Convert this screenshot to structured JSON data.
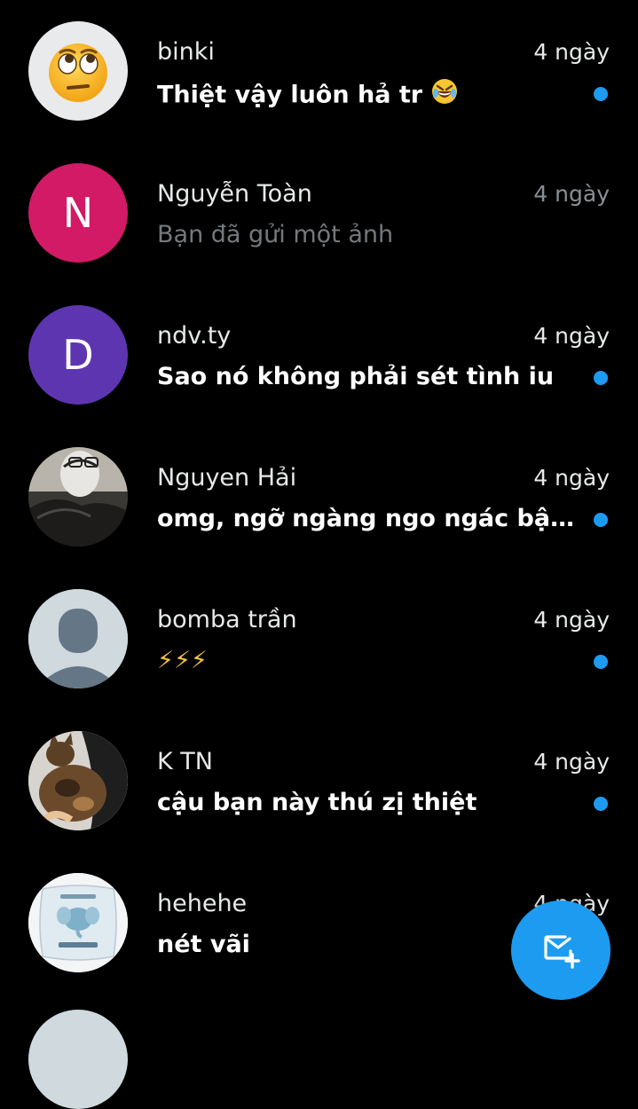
{
  "conversations": [
    {
      "name": "binki",
      "time": "4 ngày",
      "preview": "Thiệt vậy luôn hả tr",
      "preview_emoji": "rolling-on-floor-laughing-icon",
      "unread": true,
      "avatar": {
        "kind": "emoji",
        "icon": "face-with-rolling-eyes-icon",
        "bg": "#e9eaec"
      }
    },
    {
      "name": "Nguyễn Toàn",
      "time": "4 ngày",
      "preview": "Bạn đã gửi một ảnh",
      "unread": false,
      "avatar": {
        "kind": "letter",
        "letter": "N",
        "bg": "#d21a66"
      }
    },
    {
      "name": "ndv.ty",
      "time": "4 ngày",
      "preview": "Sao nó không phải sét tình iu",
      "unread": true,
      "avatar": {
        "kind": "letter",
        "letter": "D",
        "bg": "#5e35b1"
      }
    },
    {
      "name": "Nguyen Hải",
      "time": "4 ngày",
      "preview": "omg, ngỡ ngàng ngo ngác bật ng...",
      "unread": true,
      "avatar": {
        "kind": "photo",
        "icon": "user-photo-icon"
      }
    },
    {
      "name": "bomba trần",
      "time": "4 ngày",
      "preview": "⚡⚡⚡",
      "unread": true,
      "avatar": {
        "kind": "default",
        "icon": "default-avatar-icon",
        "bg": "#cfd9de"
      }
    },
    {
      "name": "K TN",
      "time": "4 ngày",
      "preview": "cậu bạn này thú zị thiệt",
      "unread": true,
      "avatar": {
        "kind": "photo",
        "icon": "cat-photo-icon"
      }
    },
    {
      "name": "hehehe",
      "time": "4 ngày",
      "preview": "nét vãi",
      "unread": false,
      "avatar": {
        "kind": "photo",
        "icon": "pillow-photo-icon"
      }
    }
  ],
  "compose_button": {
    "icon": "new-message-icon",
    "color": "#1d9bf0"
  },
  "colors": {
    "background": "#000000",
    "unread_dot": "#1d9bf0",
    "read_text": "#75797e"
  }
}
